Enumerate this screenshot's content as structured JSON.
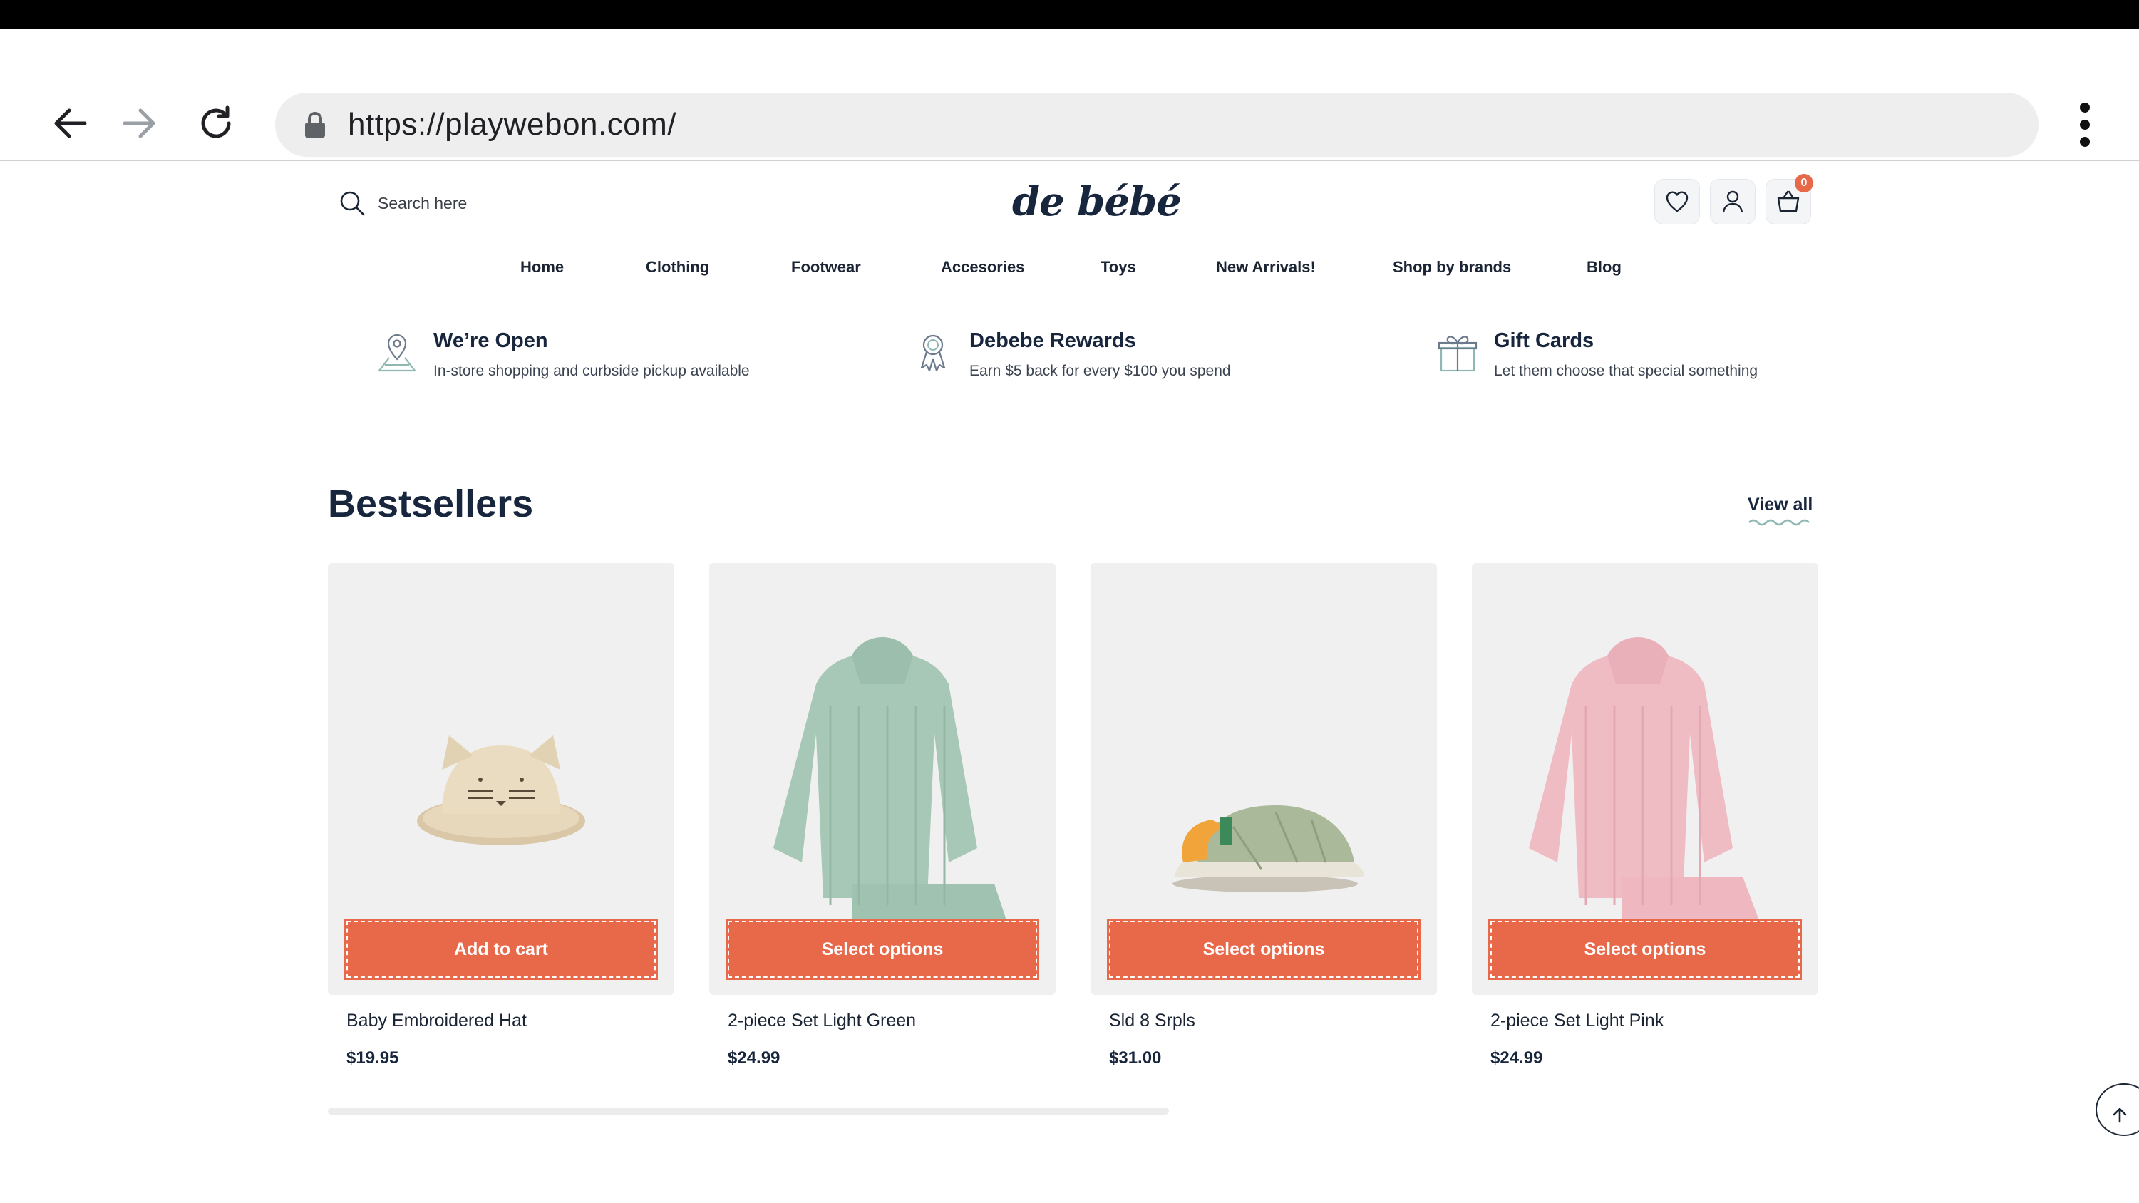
{
  "browser": {
    "url": "https://playwebon.com/"
  },
  "header": {
    "search_placeholder": "Search here",
    "logo": "de bébé",
    "cart_count": "0"
  },
  "nav": [
    "Home",
    "Clothing",
    "Footwear",
    "Accesories",
    "Toys",
    "New Arrivals!",
    "Shop by brands",
    "Blog"
  ],
  "features": [
    {
      "icon": "map-pin-icon",
      "title": "We’re Open",
      "subtitle": "In-store shopping and curbside pickup available"
    },
    {
      "icon": "award-ribbon-icon",
      "title": "Debebe Rewards",
      "subtitle": "Earn $5 back for every $100 you spend"
    },
    {
      "icon": "gift-icon",
      "title": "Gift Cards",
      "subtitle": "Let them choose that special something"
    }
  ],
  "bestsellers": {
    "title": "Bestsellers",
    "view_all": "View all",
    "products": [
      {
        "name": "Baby Embroidered Hat",
        "price": "$19.95",
        "button": "Add to cart"
      },
      {
        "name": "2-piece Set Light Green",
        "price": "$24.99",
        "button": "Select options"
      },
      {
        "name": "Sld 8 Srpls",
        "price": "$31.00",
        "button": "Select options"
      },
      {
        "name": "2-piece Set Light Pink",
        "price": "$24.99",
        "button": "Select options"
      }
    ]
  },
  "colors": {
    "accent": "#e8684a",
    "text_dark": "#17263d",
    "card_bg": "#f0f0f0"
  }
}
